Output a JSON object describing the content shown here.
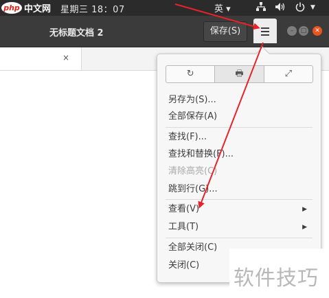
{
  "system_bar": {
    "logo_text": "php",
    "logo_site": "中文网",
    "clock": "星期三 18：07",
    "input_method": "英 ▾",
    "network_icon": "network-icon",
    "volume_icon": "volume-icon",
    "power_icon": "power-icon"
  },
  "window": {
    "title": "无标题文档 2",
    "save_label": "保存(S)",
    "menu_icon": "hamburger-menu-icon",
    "minimize_icon": "minimize-icon",
    "maximize_icon": "maximize-icon",
    "close_icon": "close-icon"
  },
  "tab": {
    "close_glyph": "×"
  },
  "menu": {
    "toolbar": [
      {
        "icon": "reload-icon",
        "glyph": "↻"
      },
      {
        "icon": "print-icon",
        "glyph": "🖶"
      },
      {
        "icon": "fullscreen-icon",
        "glyph": "⤢"
      }
    ],
    "items": [
      {
        "label": "另存为(S)...",
        "enabled": true
      },
      {
        "label": "全部保存(A)",
        "enabled": true
      },
      {
        "label": "查找(F)...",
        "enabled": true
      },
      {
        "label": "查找和替换(F)...",
        "enabled": true
      },
      {
        "label": "清除高亮(C)",
        "enabled": false
      },
      {
        "label": "跳到行(G)...",
        "enabled": true
      },
      {
        "label": "查看(V)",
        "enabled": true,
        "submenu": true
      },
      {
        "label": "工具(T)",
        "enabled": true,
        "submenu": true
      },
      {
        "label": "全部关闭(C)",
        "enabled": true
      },
      {
        "label": "关闭(C)",
        "enabled": true
      }
    ],
    "submenu_glyph": "▶"
  },
  "watermark": {
    "text": "软件技巧"
  },
  "colors": {
    "annotation_arrow": "#e8222a",
    "close_button": "#e9541f",
    "headerbar": "#3b3b3b"
  }
}
